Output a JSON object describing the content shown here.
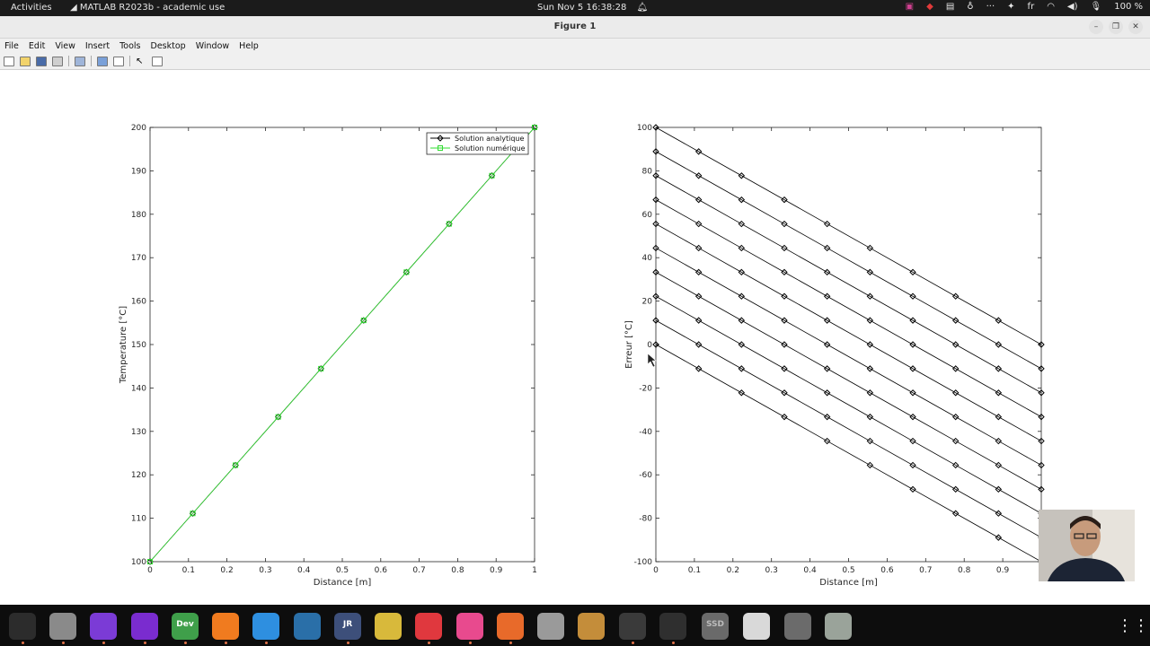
{
  "topbar": {
    "activities": "Activities",
    "app": "MATLAB R2023b - academic use",
    "clock": "Sun Nov 5  16:38:28",
    "lang": "fr",
    "battery": "100 %"
  },
  "window": {
    "title": "Figure 1"
  },
  "menu": [
    "File",
    "Edit",
    "View",
    "Insert",
    "Tools",
    "Desktop",
    "Window",
    "Help"
  ],
  "chart_data": [
    {
      "type": "line",
      "xlabel": "Distance [m]",
      "ylabel": "Temperature [°C]",
      "xlim": [
        0,
        1
      ],
      "ylim": [
        100,
        200
      ],
      "xticks": [
        "0",
        "0.1",
        "0.2",
        "0.3",
        "0.4",
        "0.5",
        "0.6",
        "0.7",
        "0.8",
        "0.9",
        "1"
      ],
      "yticks": [
        "100",
        "110",
        "120",
        "130",
        "140",
        "150",
        "160",
        "170",
        "180",
        "190",
        "200"
      ],
      "legend_position": "top-right",
      "series": [
        {
          "name": "Solution analytique",
          "color": "#000000",
          "marker": "diamond",
          "x": [
            0,
            0.1111,
            0.2222,
            0.3333,
            0.4444,
            0.5556,
            0.6667,
            0.7778,
            0.8889,
            1
          ],
          "y": [
            100,
            111.11,
            122.22,
            133.33,
            144.44,
            155.56,
            166.67,
            177.78,
            188.89,
            200
          ]
        },
        {
          "name": "Solution numérique",
          "color": "#32dc32",
          "marker": "square",
          "x": [
            0,
            0.1111,
            0.2222,
            0.3333,
            0.4444,
            0.5556,
            0.6667,
            0.7778,
            0.8889,
            1
          ],
          "y": [
            100,
            111.11,
            122.22,
            133.33,
            144.44,
            155.56,
            166.67,
            177.78,
            188.89,
            200
          ]
        }
      ]
    },
    {
      "type": "line",
      "xlabel": "Distance [m]",
      "ylabel": "Erreur [°C]",
      "xlim": [
        0,
        1
      ],
      "ylim": [
        -100,
        100
      ],
      "xticks": [
        "0",
        "0.1",
        "0.2",
        "0.3",
        "0.4",
        "0.5",
        "0.6",
        "0.7",
        "0.8",
        "0.9"
      ],
      "yticks": [
        "-100",
        "-80",
        "-60",
        "-40",
        "-20",
        "0",
        "20",
        "40",
        "60",
        "80",
        "100"
      ],
      "color": "#000000",
      "marker": "diamond",
      "series": [
        {
          "x": [
            0,
            0.1111,
            0.2222,
            0.3333,
            0.4444,
            0.5556,
            0.6667,
            0.7778,
            0.8889,
            1
          ],
          "y": [
            100,
            88.89,
            77.78,
            66.67,
            55.56,
            44.44,
            33.33,
            22.22,
            11.11,
            0
          ]
        },
        {
          "x": [
            0,
            0.1111,
            0.2222,
            0.3333,
            0.4444,
            0.5556,
            0.6667,
            0.7778,
            0.8889,
            1
          ],
          "y": [
            88.89,
            77.78,
            66.67,
            55.56,
            44.44,
            33.33,
            22.22,
            11.11,
            0,
            -11.11
          ]
        },
        {
          "x": [
            0,
            0.1111,
            0.2222,
            0.3333,
            0.4444,
            0.5556,
            0.6667,
            0.7778,
            0.8889,
            1
          ],
          "y": [
            77.78,
            66.67,
            55.56,
            44.44,
            33.33,
            22.22,
            11.11,
            0,
            -11.11,
            -22.22
          ]
        },
        {
          "x": [
            0,
            0.1111,
            0.2222,
            0.3333,
            0.4444,
            0.5556,
            0.6667,
            0.7778,
            0.8889,
            1
          ],
          "y": [
            66.67,
            55.56,
            44.44,
            33.33,
            22.22,
            11.11,
            0,
            -11.11,
            -22.22,
            -33.33
          ]
        },
        {
          "x": [
            0,
            0.1111,
            0.2222,
            0.3333,
            0.4444,
            0.5556,
            0.6667,
            0.7778,
            0.8889,
            1
          ],
          "y": [
            55.56,
            44.44,
            33.33,
            22.22,
            11.11,
            0,
            -11.11,
            -22.22,
            -33.33,
            -44.44
          ]
        },
        {
          "x": [
            0,
            0.1111,
            0.2222,
            0.3333,
            0.4444,
            0.5556,
            0.6667,
            0.7778,
            0.8889,
            1
          ],
          "y": [
            44.44,
            33.33,
            22.22,
            11.11,
            0,
            -11.11,
            -22.22,
            -33.33,
            -44.44,
            -55.56
          ]
        },
        {
          "x": [
            0,
            0.1111,
            0.2222,
            0.3333,
            0.4444,
            0.5556,
            0.6667,
            0.7778,
            0.8889,
            1
          ],
          "y": [
            33.33,
            22.22,
            11.11,
            0,
            -11.11,
            -22.22,
            -33.33,
            -44.44,
            -55.56,
            -66.67
          ]
        },
        {
          "x": [
            0,
            0.1111,
            0.2222,
            0.3333,
            0.4444,
            0.5556,
            0.6667,
            0.7778,
            0.8889,
            1
          ],
          "y": [
            22.22,
            11.11,
            0,
            -11.11,
            -22.22,
            -33.33,
            -44.44,
            -55.56,
            -66.67,
            -77.78
          ]
        },
        {
          "x": [
            0,
            0.1111,
            0.2222,
            0.3333,
            0.4444,
            0.5556,
            0.6667,
            0.7778,
            0.8889,
            1
          ],
          "y": [
            11.11,
            0,
            -11.11,
            -22.22,
            -33.33,
            -44.44,
            -55.56,
            -66.67,
            -77.78,
            -88.89
          ]
        },
        {
          "x": [
            0,
            0.1111,
            0.2222,
            0.3333,
            0.4444,
            0.5556,
            0.6667,
            0.7778,
            0.8889,
            1
          ],
          "y": [
            0,
            -11.11,
            -22.22,
            -33.33,
            -44.44,
            -55.56,
            -66.67,
            -77.78,
            -88.89,
            -100
          ]
        }
      ]
    }
  ],
  "dock": {
    "apps": [
      {
        "icon": "terminal-icon",
        "color": "#2c2c2c"
      },
      {
        "icon": "files-icon",
        "color": "#8a8a8a"
      },
      {
        "icon": "brave-icon",
        "color": "#7b3bd6"
      },
      {
        "icon": "podcast-icon",
        "color": "#7a2ccf"
      },
      {
        "icon": "chrome-dev-icon",
        "color": "#3f9f4a"
      },
      {
        "icon": "firefox-icon",
        "color": "#f07b1f"
      },
      {
        "icon": "firefox-dev-icon",
        "color": "#2e8fe0"
      },
      {
        "icon": "kalkulator-icon",
        "color": "#2a6fa8"
      },
      {
        "icon": "jr-icon",
        "color": "#3d4f7a"
      },
      {
        "icon": "teapot-icon",
        "color": "#d8b93b"
      },
      {
        "icon": "anydesk-icon",
        "color": "#e0383e"
      },
      {
        "icon": "download-icon",
        "color": "#e84a8e"
      },
      {
        "icon": "app-store-icon",
        "color": "#e86a2a"
      },
      {
        "icon": "accessibility-icon",
        "color": "#9a9a9a"
      },
      {
        "icon": "search-tool-icon",
        "color": "#c48d3a"
      },
      {
        "icon": "system-monitor-icon",
        "color": "#3a3a3a"
      },
      {
        "icon": "matlab-icon",
        "color": "#2f2f2f"
      },
      {
        "icon": "ssd-icon",
        "color": "#6a6a6a"
      },
      {
        "icon": "document-viewer-icon",
        "color": "#d9d9d9"
      },
      {
        "icon": "disk-icon",
        "color": "#6b6b6b"
      },
      {
        "icon": "trash-icon",
        "color": "#9aa39a"
      }
    ],
    "ssd_label": "SSD",
    "jr_label": "JR",
    "dev_label": "Dev"
  }
}
